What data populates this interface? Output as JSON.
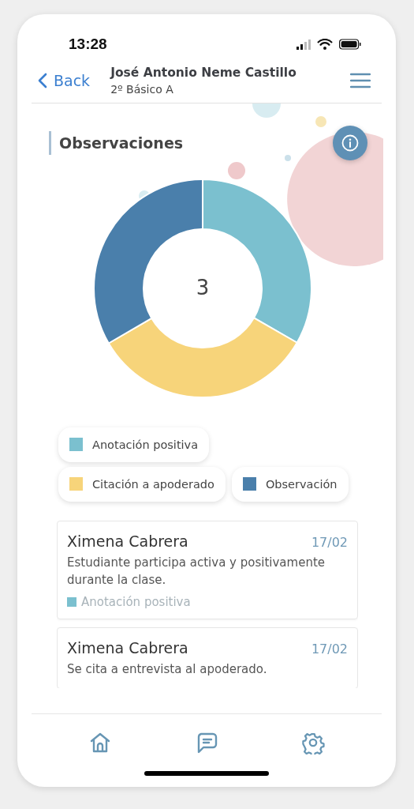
{
  "status_bar": {
    "time": "13:28"
  },
  "header": {
    "back": "Back",
    "title": "José Antonio Neme Castillo",
    "subtitle": "2º Básico A"
  },
  "section": {
    "title": "Observaciones"
  },
  "chart": {
    "center_value": "3",
    "chart_data": {
      "type": "donut",
      "values": [
        33.3,
        33.3,
        33.4
      ]
    }
  },
  "legend": [
    {
      "label": "Anotación positiva",
      "color": "#7bc0cf"
    },
    {
      "label": "Citación a apoderado",
      "color": "#f7d47a"
    },
    {
      "label": "Observación",
      "color": "#4a7fab"
    }
  ],
  "entries": [
    {
      "author": "Ximena Cabrera",
      "date": "17/02",
      "text": "Estudiante participa activa y positivamente durante la clase.",
      "tag": "Anotación positiva",
      "color": "#7bc0cf"
    },
    {
      "author": "Ximena Cabrera",
      "date": "17/02",
      "text": "Se cita a entrevista al apoderado."
    }
  ],
  "tab_bar": [
    {
      "kind": "home"
    },
    {
      "kind": "messages"
    },
    {
      "kind": "settings"
    }
  ]
}
